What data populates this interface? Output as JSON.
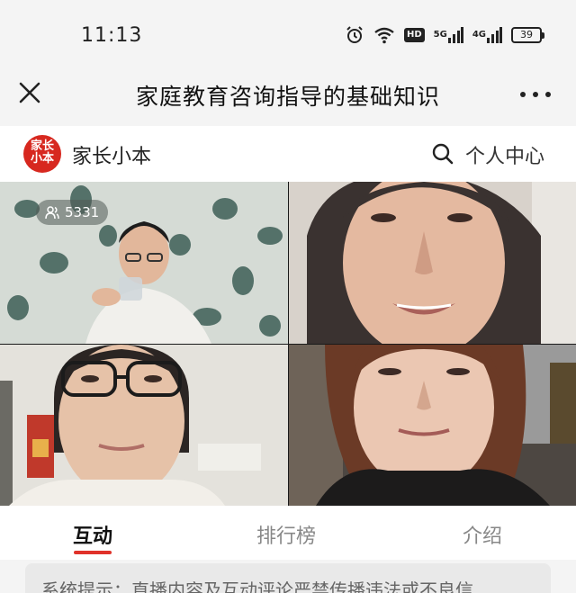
{
  "status_bar": {
    "time": "11:13",
    "hd_label": "HD",
    "net_5g": "5G",
    "net_4g": "4G",
    "battery_level": "39",
    "icons": [
      "alarm-icon",
      "wifi-icon",
      "hd-icon",
      "signal-5g-icon",
      "signal-4g-icon",
      "battery-icon"
    ]
  },
  "title_bar": {
    "title": "家庭教育咨询指导的基础知识",
    "close_icon": "close-icon",
    "more_icon": "more-dots-icon"
  },
  "brand": {
    "logo_text_top": "家长",
    "logo_text_bottom": "小本",
    "name": "家长小本",
    "search_icon": "search-icon",
    "personal_center": "个人中心",
    "accent": "#d7281f"
  },
  "live": {
    "viewer_count": "5331",
    "viewer_icon": "people-icon"
  },
  "tabs": [
    {
      "label": "互动",
      "active": true
    },
    {
      "label": "排行榜",
      "active": false
    },
    {
      "label": "介绍",
      "active": false
    }
  ],
  "notice": {
    "text": "系统提示：直播内容及互动评论严禁传播违法或不良信"
  }
}
